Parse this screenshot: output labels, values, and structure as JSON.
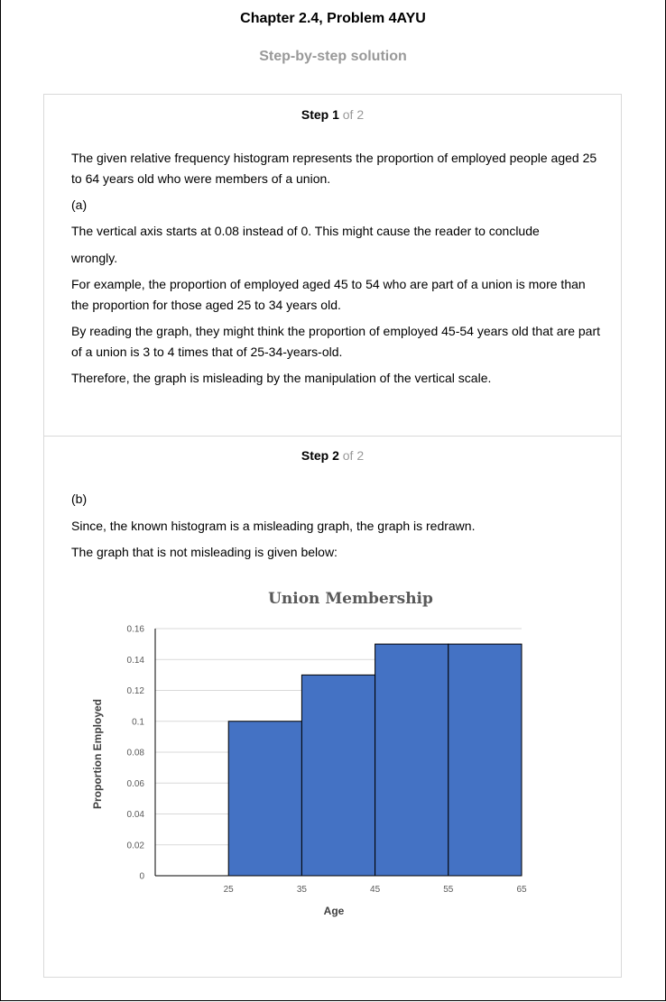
{
  "header": {
    "title": "Chapter 2.4, Problem 4AYU",
    "subtitle": "Step-by-step solution"
  },
  "step1": {
    "label": "Step 1",
    "of": "of 2",
    "p1": "The given relative frequency histogram represents the proportion of employed people aged 25 to 64 years old who were members of a union.",
    "p2": "(a)",
    "p3": "The vertical axis starts at 0.08 instead of 0. This might cause the reader to conclude",
    "p4": "wrongly.",
    "p5": "For example, the proportion of employed aged 45 to 54 who are part of a union is more than the proportion for those aged 25 to 34 years old.",
    "p6": "By reading the graph, they might think the proportion of employed 45-54 years old that are part of a union is 3 to 4 times that of 25-34-years-old.",
    "p7": "Therefore, the graph is misleading by the manipulation of the vertical scale."
  },
  "step2": {
    "label": "Step 2",
    "of": "of 2",
    "p1": "(b)",
    "p2": "Since, the known histogram is a misleading graph, the graph is redrawn.",
    "p3": "The graph that is not misleading is given below:"
  },
  "chart_data": {
    "type": "bar",
    "title": "Union Membership",
    "xlabel": "Age",
    "ylabel": "Proportion Employed",
    "x_ticks": [
      "25",
      "35",
      "45",
      "55",
      "65"
    ],
    "y_ticks": [
      "0",
      "0.02",
      "0.04",
      "0.06",
      "0.08",
      "0.1",
      "0.12",
      "0.14",
      "0.16"
    ],
    "ylim": [
      0,
      0.16
    ],
    "xlim": [
      15,
      65
    ],
    "bins": [
      {
        "start": 25,
        "end": 35,
        "value": 0.1
      },
      {
        "start": 35,
        "end": 45,
        "value": 0.13
      },
      {
        "start": 45,
        "end": 55,
        "value": 0.15
      },
      {
        "start": 55,
        "end": 65,
        "value": 0.15
      }
    ],
    "bar_color": "#4472c4",
    "grid": true
  }
}
